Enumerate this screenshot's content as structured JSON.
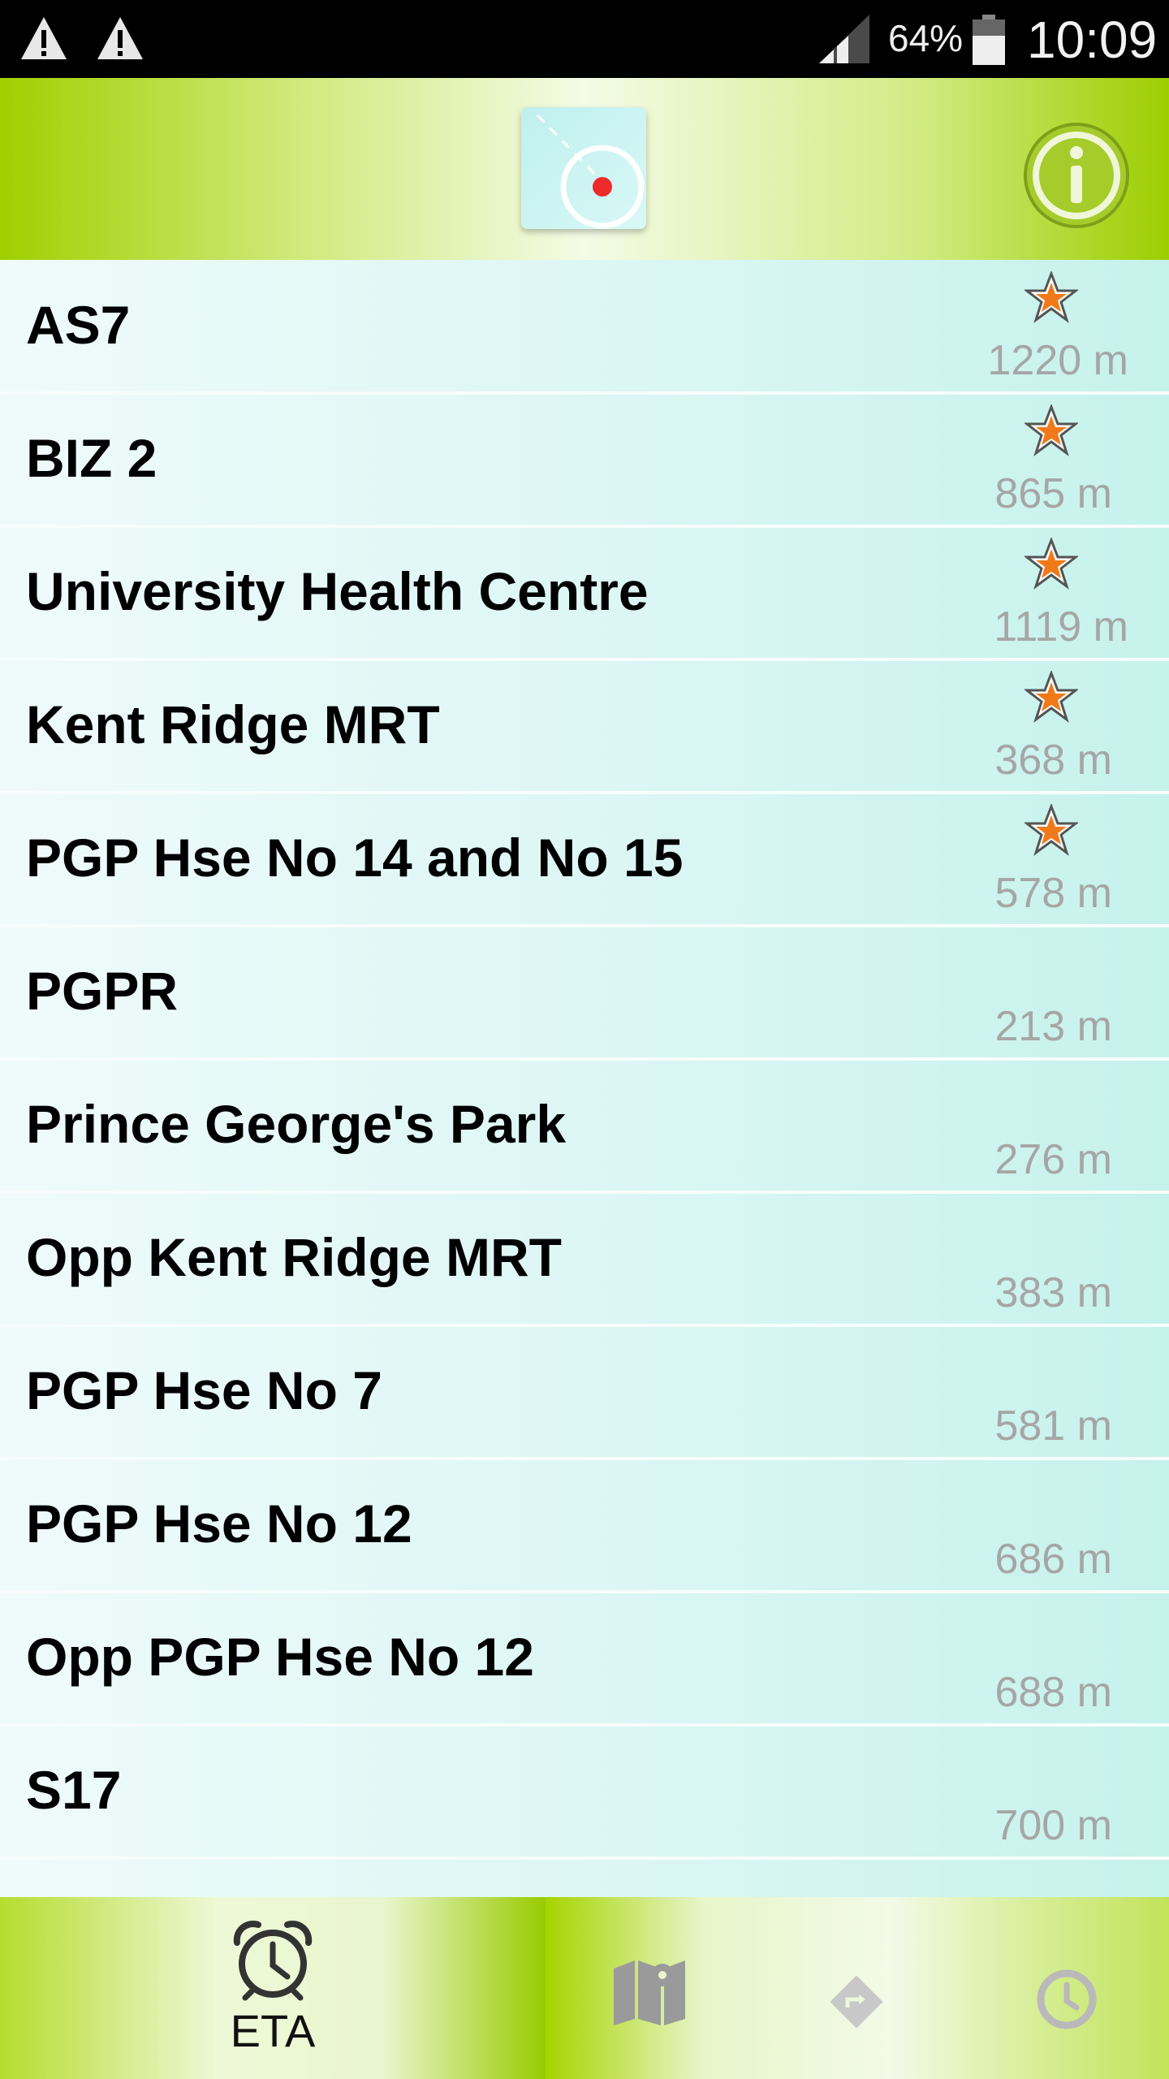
{
  "status_bar": {
    "battery": "64%",
    "time": "10:09"
  },
  "stops": [
    {
      "name": "AS7",
      "distance": "1220 m",
      "favorite": true
    },
    {
      "name": "BIZ 2",
      "distance": "865 m",
      "favorite": true
    },
    {
      "name": "University Health Centre",
      "distance": "1119 m",
      "favorite": true
    },
    {
      "name": "Kent Ridge MRT",
      "distance": "368 m",
      "favorite": true
    },
    {
      "name": "PGP Hse No 14 and No 15",
      "distance": "578 m",
      "favorite": true
    },
    {
      "name": "PGPR",
      "distance": "213 m",
      "favorite": false
    },
    {
      "name": "Prince George's Park",
      "distance": "276 m",
      "favorite": false
    },
    {
      "name": "Opp Kent Ridge MRT",
      "distance": "383 m",
      "favorite": false
    },
    {
      "name": "PGP Hse No 7",
      "distance": "581 m",
      "favorite": false
    },
    {
      "name": "PGP Hse No 12",
      "distance": "686 m",
      "favorite": false
    },
    {
      "name": "Opp PGP Hse No 12",
      "distance": "688 m",
      "favorite": false
    },
    {
      "name": "S17",
      "distance": "700 m",
      "favorite": false
    }
  ],
  "bottom_nav": {
    "tabs": [
      {
        "label": "ETA",
        "icon": "alarm-clock-icon",
        "active": true
      },
      {
        "label": "",
        "icon": "map-icon",
        "active": false
      },
      {
        "label": "",
        "icon": "directions-icon",
        "active": false
      },
      {
        "label": "",
        "icon": "clock-icon",
        "active": false
      }
    ]
  },
  "colors": {
    "header_green": "#9fd000",
    "star_orange": "#f07a1a",
    "list_teal": "#c6f2ec"
  }
}
